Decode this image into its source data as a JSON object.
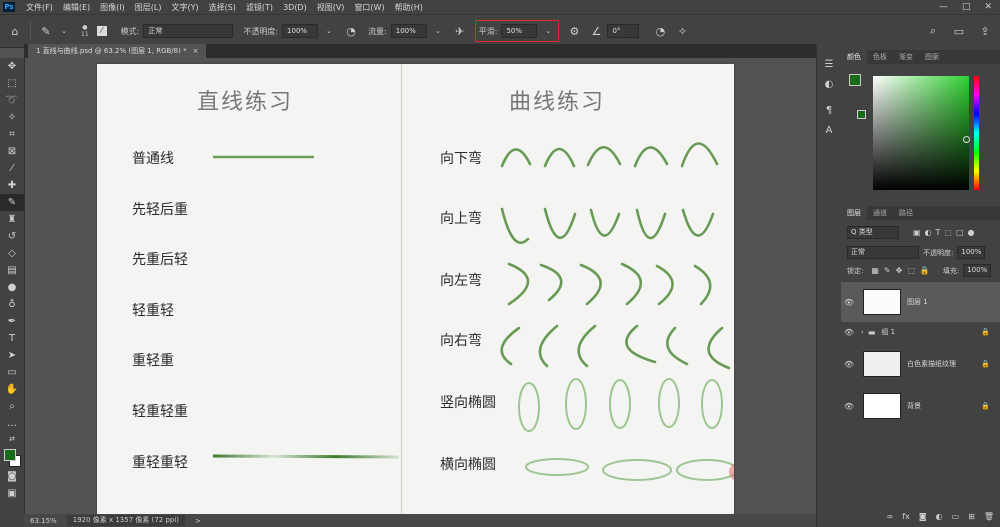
{
  "app": {
    "logo": "Ps"
  },
  "menu": [
    "文件(F)",
    "编辑(E)",
    "图像(I)",
    "图层(L)",
    "文字(Y)",
    "选择(S)",
    "滤镜(T)",
    "3D(D)",
    "视图(V)",
    "窗口(W)",
    "帮助(H)"
  ],
  "window_controls": {
    "min": "—",
    "max": "□",
    "close": "✕"
  },
  "options": {
    "brush_size": "11",
    "mode_label": "模式:",
    "mode_value": "正常",
    "opacity_label": "不透明度:",
    "opacity_value": "100%",
    "flow_label": "流量:",
    "flow_value": "100%",
    "smooth_label": "平滑:",
    "smooth_value": "50%",
    "angle_value": "0°"
  },
  "doc_tab": {
    "label": "1 直线与曲线.psd @ 63.2% (图层 1, RGB/8) *",
    "close": "×"
  },
  "canvas": {
    "left_title": "直线练习",
    "right_title": "曲线练习",
    "left_labels": [
      "普通线",
      "先轻后重",
      "先重后轻",
      "轻重轻",
      "重轻重",
      "轻重轻重",
      "重轻重轻"
    ],
    "right_labels": [
      "向下弯",
      "向上弯",
      "向左弯",
      "向右弯",
      "竖向椭圆",
      "横向椭圆"
    ],
    "stroke_color": "#3a7a2a"
  },
  "status": {
    "zoom": "63.15%",
    "info": "1920 像素 x 1357 像素 (72 ppi)",
    "arrow": ">"
  },
  "color_panel": {
    "tabs": [
      "颜色",
      "色板",
      "渐变",
      "图案"
    ],
    "foreground": "#1a6b1a"
  },
  "layers_panel": {
    "tabs": [
      "图层",
      "通道",
      "路径"
    ],
    "filter_label": "Q 类型",
    "blend_mode": "正常",
    "opacity_label": "不透明度:",
    "opacity_value": "100%",
    "lock_label": "锁定:",
    "fill_label": "填充:",
    "fill_value": "100%",
    "layers": [
      {
        "name": "图层 1"
      },
      {
        "name": "组 1"
      },
      {
        "name": "白色素描纸纹理"
      },
      {
        "name": "背景"
      }
    ]
  }
}
